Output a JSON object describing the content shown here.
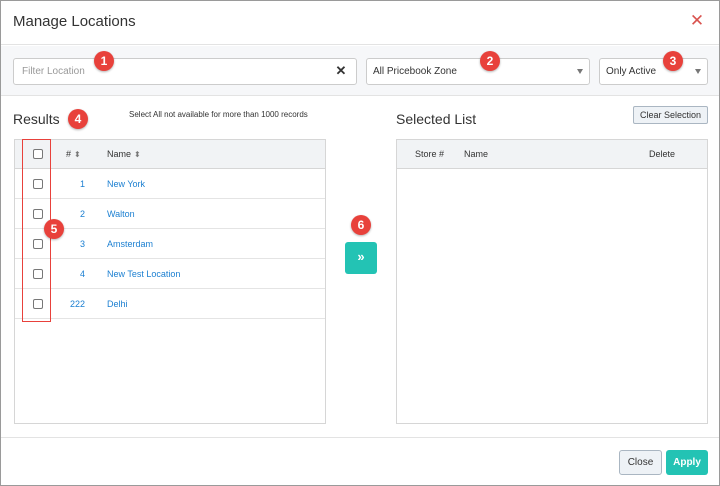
{
  "dialog": {
    "title": "Manage Locations",
    "close_icon": "close-icon"
  },
  "filter": {
    "placeholder": "Filter Location",
    "value": "",
    "clear_icon": "clear-icon",
    "zone_select": "All Pricebook Zone",
    "status_select": "Only Active"
  },
  "results": {
    "title": "Results",
    "note": "Select All not available for more than 1000 records",
    "columns": {
      "number": "#",
      "name": "Name"
    },
    "rows": [
      {
        "number": "1",
        "name": "New York"
      },
      {
        "number": "2",
        "name": "Walton"
      },
      {
        "number": "3",
        "name": "Amsterdam"
      },
      {
        "number": "4",
        "name": "New Test Location"
      },
      {
        "number": "222",
        "name": "Delhi"
      }
    ]
  },
  "selected": {
    "title": "Selected List",
    "clear_label": "Clear Selection",
    "columns": {
      "store": "Store #",
      "name": "Name",
      "delete": "Delete"
    }
  },
  "move_button": {
    "label": "»"
  },
  "callouts": [
    "1",
    "2",
    "3",
    "4",
    "5",
    "6"
  ],
  "footer": {
    "close_label": "Close",
    "apply_label": "Apply"
  },
  "colors": {
    "accent": "#23c3b4",
    "link": "#1b7fd1",
    "callout": "#e8413b",
    "close_x": "#d9534f"
  }
}
